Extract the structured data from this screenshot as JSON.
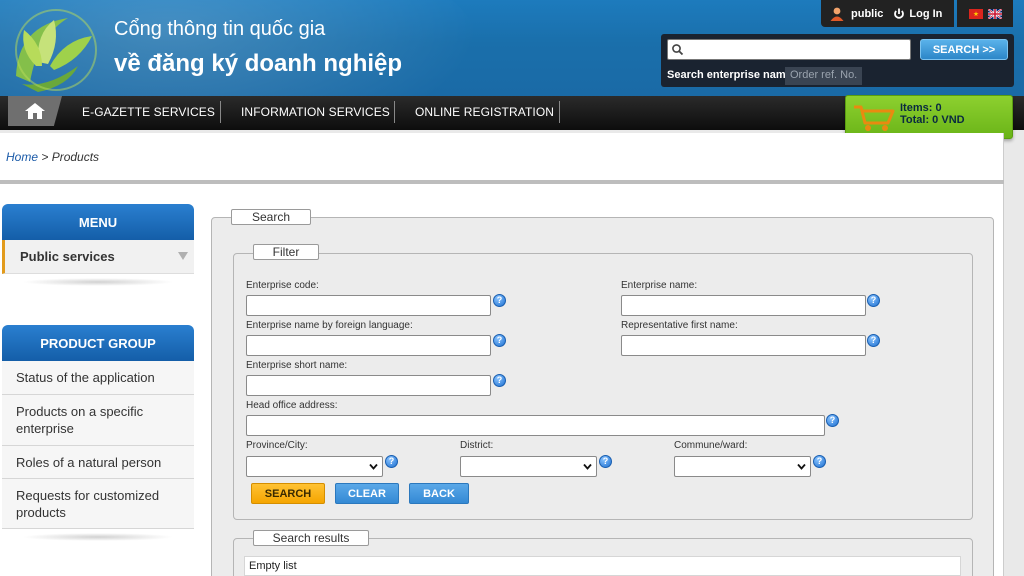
{
  "header": {
    "title_line1": "Cổng thông tin quốc gia",
    "title_line2": "về đăng ký doanh nghiệp",
    "user_name": "public",
    "login_label": "Log In",
    "search": {
      "placeholder": "",
      "button_label": "SEARCH >>",
      "tab_active": "Search enterprise name",
      "tab_inactive": "Order ref. No."
    }
  },
  "nav": {
    "items": [
      "E-GAZETTE SERVICES",
      "INFORMATION SERVICES",
      "ONLINE REGISTRATION"
    ]
  },
  "cart": {
    "items_label": "Items: 0",
    "total_label": "Total: 0 VND"
  },
  "breadcrumb": {
    "home": "Home",
    "separator": " > ",
    "current": "Products"
  },
  "sidebar": {
    "menu_title": "MENU",
    "menu_items": [
      "Public services"
    ],
    "product_group_title": "PRODUCT GROUP",
    "product_items": [
      "Status of the application",
      "Products on a specific enterprise",
      "Roles of a natural person",
      "Requests for customized products"
    ]
  },
  "main": {
    "search_legend": "Search",
    "filter_legend": "Filter",
    "fields": {
      "enterprise_code": "Enterprise code:",
      "enterprise_name": "Enterprise name:",
      "foreign_name": "Enterprise name by foreign language:",
      "representative": "Representative first name:",
      "short_name": "Enterprise short name:",
      "head_office": "Head office address:",
      "province": "Province/City:",
      "district": "District:",
      "commune": "Commune/ward:"
    },
    "buttons": {
      "search": "SEARCH",
      "clear": "CLEAR",
      "back": "BACK"
    },
    "results_legend": "Search results",
    "results_empty": "Empty list"
  },
  "colors": {
    "header_blue": "#1a6fab",
    "nav_black": "#111111",
    "cart_green": "#7cc226",
    "accent_orange": "#f6a800",
    "button_blue": "#3c93db",
    "sidebar_blue": "#1f6fc0"
  }
}
